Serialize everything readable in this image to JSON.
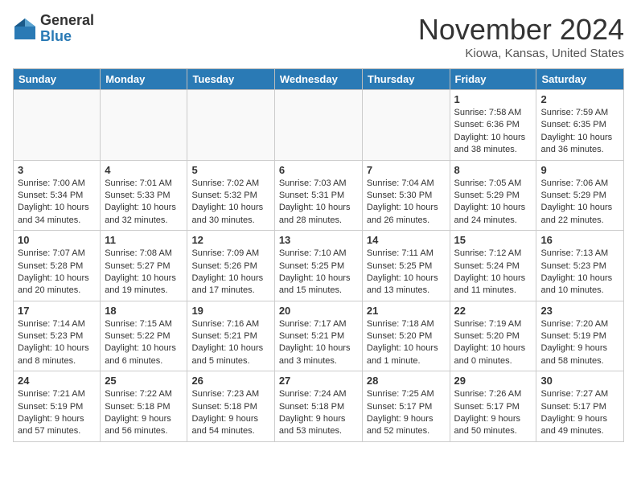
{
  "header": {
    "logo_general": "General",
    "logo_blue": "Blue",
    "month_title": "November 2024",
    "location": "Kiowa, Kansas, United States"
  },
  "days_of_week": [
    "Sunday",
    "Monday",
    "Tuesday",
    "Wednesday",
    "Thursday",
    "Friday",
    "Saturday"
  ],
  "weeks": [
    [
      {
        "day": "",
        "info": ""
      },
      {
        "day": "",
        "info": ""
      },
      {
        "day": "",
        "info": ""
      },
      {
        "day": "",
        "info": ""
      },
      {
        "day": "",
        "info": ""
      },
      {
        "day": "1",
        "info": "Sunrise: 7:58 AM\nSunset: 6:36 PM\nDaylight: 10 hours and 38 minutes."
      },
      {
        "day": "2",
        "info": "Sunrise: 7:59 AM\nSunset: 6:35 PM\nDaylight: 10 hours and 36 minutes."
      }
    ],
    [
      {
        "day": "3",
        "info": "Sunrise: 7:00 AM\nSunset: 5:34 PM\nDaylight: 10 hours and 34 minutes."
      },
      {
        "day": "4",
        "info": "Sunrise: 7:01 AM\nSunset: 5:33 PM\nDaylight: 10 hours and 32 minutes."
      },
      {
        "day": "5",
        "info": "Sunrise: 7:02 AM\nSunset: 5:32 PM\nDaylight: 10 hours and 30 minutes."
      },
      {
        "day": "6",
        "info": "Sunrise: 7:03 AM\nSunset: 5:31 PM\nDaylight: 10 hours and 28 minutes."
      },
      {
        "day": "7",
        "info": "Sunrise: 7:04 AM\nSunset: 5:30 PM\nDaylight: 10 hours and 26 minutes."
      },
      {
        "day": "8",
        "info": "Sunrise: 7:05 AM\nSunset: 5:29 PM\nDaylight: 10 hours and 24 minutes."
      },
      {
        "day": "9",
        "info": "Sunrise: 7:06 AM\nSunset: 5:29 PM\nDaylight: 10 hours and 22 minutes."
      }
    ],
    [
      {
        "day": "10",
        "info": "Sunrise: 7:07 AM\nSunset: 5:28 PM\nDaylight: 10 hours and 20 minutes."
      },
      {
        "day": "11",
        "info": "Sunrise: 7:08 AM\nSunset: 5:27 PM\nDaylight: 10 hours and 19 minutes."
      },
      {
        "day": "12",
        "info": "Sunrise: 7:09 AM\nSunset: 5:26 PM\nDaylight: 10 hours and 17 minutes."
      },
      {
        "day": "13",
        "info": "Sunrise: 7:10 AM\nSunset: 5:25 PM\nDaylight: 10 hours and 15 minutes."
      },
      {
        "day": "14",
        "info": "Sunrise: 7:11 AM\nSunset: 5:25 PM\nDaylight: 10 hours and 13 minutes."
      },
      {
        "day": "15",
        "info": "Sunrise: 7:12 AM\nSunset: 5:24 PM\nDaylight: 10 hours and 11 minutes."
      },
      {
        "day": "16",
        "info": "Sunrise: 7:13 AM\nSunset: 5:23 PM\nDaylight: 10 hours and 10 minutes."
      }
    ],
    [
      {
        "day": "17",
        "info": "Sunrise: 7:14 AM\nSunset: 5:23 PM\nDaylight: 10 hours and 8 minutes."
      },
      {
        "day": "18",
        "info": "Sunrise: 7:15 AM\nSunset: 5:22 PM\nDaylight: 10 hours and 6 minutes."
      },
      {
        "day": "19",
        "info": "Sunrise: 7:16 AM\nSunset: 5:21 PM\nDaylight: 10 hours and 5 minutes."
      },
      {
        "day": "20",
        "info": "Sunrise: 7:17 AM\nSunset: 5:21 PM\nDaylight: 10 hours and 3 minutes."
      },
      {
        "day": "21",
        "info": "Sunrise: 7:18 AM\nSunset: 5:20 PM\nDaylight: 10 hours and 1 minute."
      },
      {
        "day": "22",
        "info": "Sunrise: 7:19 AM\nSunset: 5:20 PM\nDaylight: 10 hours and 0 minutes."
      },
      {
        "day": "23",
        "info": "Sunrise: 7:20 AM\nSunset: 5:19 PM\nDaylight: 9 hours and 58 minutes."
      }
    ],
    [
      {
        "day": "24",
        "info": "Sunrise: 7:21 AM\nSunset: 5:19 PM\nDaylight: 9 hours and 57 minutes."
      },
      {
        "day": "25",
        "info": "Sunrise: 7:22 AM\nSunset: 5:18 PM\nDaylight: 9 hours and 56 minutes."
      },
      {
        "day": "26",
        "info": "Sunrise: 7:23 AM\nSunset: 5:18 PM\nDaylight: 9 hours and 54 minutes."
      },
      {
        "day": "27",
        "info": "Sunrise: 7:24 AM\nSunset: 5:18 PM\nDaylight: 9 hours and 53 minutes."
      },
      {
        "day": "28",
        "info": "Sunrise: 7:25 AM\nSunset: 5:17 PM\nDaylight: 9 hours and 52 minutes."
      },
      {
        "day": "29",
        "info": "Sunrise: 7:26 AM\nSunset: 5:17 PM\nDaylight: 9 hours and 50 minutes."
      },
      {
        "day": "30",
        "info": "Sunrise: 7:27 AM\nSunset: 5:17 PM\nDaylight: 9 hours and 49 minutes."
      }
    ]
  ]
}
